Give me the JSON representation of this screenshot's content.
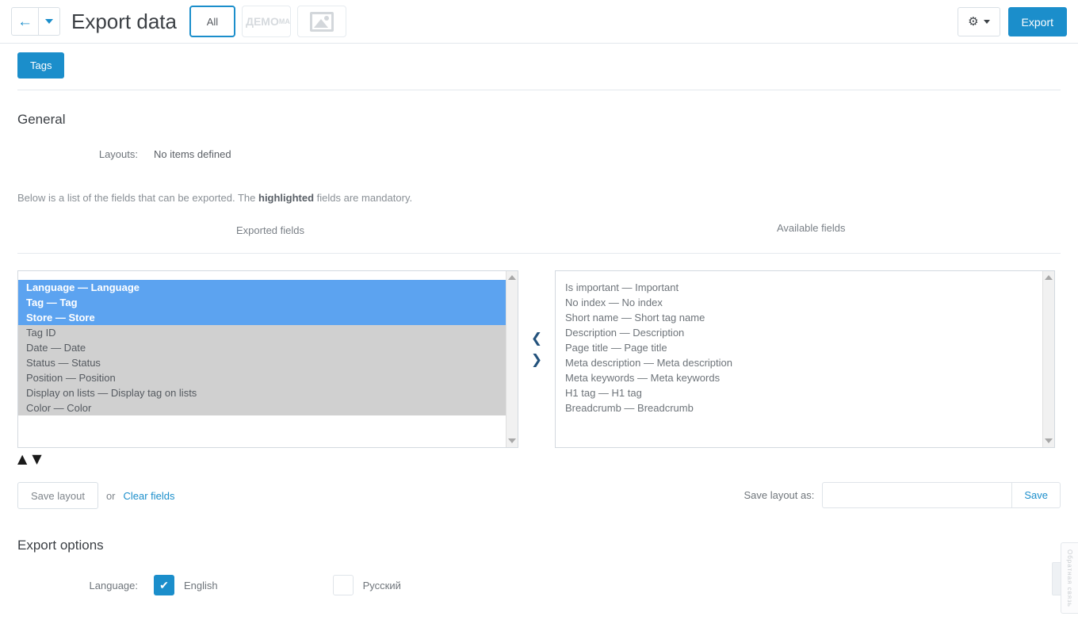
{
  "topbar": {
    "back_icon": "arrow-left-icon",
    "back_caret_icon": "chevron-down-icon",
    "title": "Export data",
    "chips": [
      {
        "label": "All",
        "state": "active"
      },
      {
        "label_big": "ДЕМО",
        "label_small": "МА",
        "state": "muted"
      }
    ],
    "image_chip_icon": "image-placeholder-icon",
    "gear_icon": "gear-icon",
    "gear_caret_icon": "chevron-down-icon",
    "export_label": "Export"
  },
  "tabs": {
    "tags_label": "Tags"
  },
  "general": {
    "title": "General",
    "layouts_label": "Layouts:",
    "layouts_value": "No items defined",
    "note_prefix": "Below is a list of the fields that can be exported. The ",
    "note_bold": "highlighted",
    "note_suffix": " fields are mandatory."
  },
  "dual_list": {
    "exported_header": "Exported fields",
    "available_header": "Available fields",
    "exported_fields": [
      {
        "label": "Language — Language",
        "selected": true
      },
      {
        "label": "Tag — Tag",
        "selected": true
      },
      {
        "label": "Store — Store",
        "selected": true
      },
      {
        "label": "Tag ID",
        "selected": false
      },
      {
        "label": "Date — Date",
        "selected": false
      },
      {
        "label": "Status — Status",
        "selected": false
      },
      {
        "label": "Position — Position",
        "selected": false
      },
      {
        "label": "Display on lists — Display tag on lists",
        "selected": false
      },
      {
        "label": "Color — Color",
        "selected": false
      }
    ],
    "available_fields": [
      {
        "label": "Is important — Important"
      },
      {
        "label": "No index — No index"
      },
      {
        "label": "Short name — Short tag name"
      },
      {
        "label": "Description — Description"
      },
      {
        "label": "Page title — Page title"
      },
      {
        "label": "Meta description — Meta description"
      },
      {
        "label": "Meta keywords — Meta keywords"
      },
      {
        "label": "H1 tag — H1 tag"
      },
      {
        "label": "Breadcrumb — Breadcrumb"
      }
    ],
    "move_left_icon": "chevron-left-icon",
    "move_right_icon": "chevron-right-icon",
    "move_up_icon": "chevron-up-icon",
    "move_down_icon": "chevron-down-icon",
    "scroll_up_icon": "scroll-arrow-up-icon",
    "scroll_down_icon": "scroll-arrow-down-icon",
    "edge_tab_label": "Обратная связь"
  },
  "layout_actions": {
    "save_layout_label": "Save layout",
    "or_label": "or",
    "clear_fields_label": "Clear fields",
    "save_layout_as_label": "Save layout as:",
    "save_layout_as_value": "",
    "save_layout_as_placeholder": "",
    "save_label": "Save"
  },
  "export_options": {
    "title": "Export options",
    "language_label": "Language:",
    "languages": [
      {
        "label": "English",
        "checked": true,
        "check_glyph": "✔"
      },
      {
        "label": "Русский",
        "checked": false,
        "check_glyph": ""
      }
    ]
  },
  "colors": {
    "accent": "#1b8ecb",
    "selection": "#5ca3f0",
    "list_bg": "#d0d0d0"
  }
}
